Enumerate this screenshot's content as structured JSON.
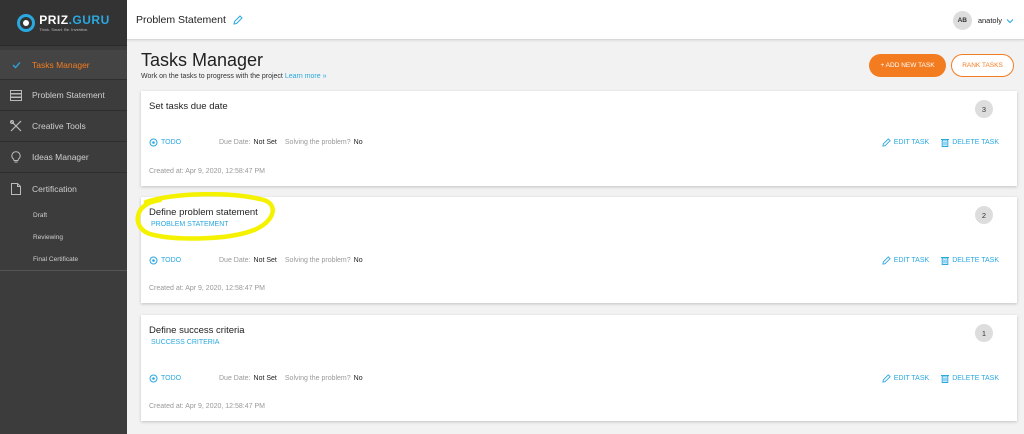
{
  "sidebar": {
    "logo": {
      "name_a": "PRIZ",
      "name_b": ".GURU",
      "tagline": "Think. Smart. Be. Inventive."
    },
    "items": [
      {
        "label": "Tasks Manager",
        "icon": "check-icon"
      },
      {
        "label": "Problem Statement",
        "icon": "list-icon"
      },
      {
        "label": "Creative Tools",
        "icon": "tools-icon"
      },
      {
        "label": "Ideas Manager",
        "icon": "lightbulb-icon"
      },
      {
        "label": "Certification",
        "icon": "document-icon"
      }
    ],
    "sub_items": [
      "Draft",
      "Reviewing",
      "Final Certificate"
    ]
  },
  "header": {
    "title": "Problem Statement",
    "user": {
      "initials": "AB",
      "name": "anatoly"
    }
  },
  "page": {
    "title": "Tasks Manager",
    "subtitle": "Work on the tasks to progress with the project",
    "learn_more": "Learn more »",
    "add_task": "+ ADD NEW TASK",
    "rank_tasks": "RANK TASKS"
  },
  "tasks": [
    {
      "title": "Set tasks due date",
      "link": "",
      "rank": "3",
      "status": "TODO",
      "due_label": "Due Date:",
      "due_value": "Not Set",
      "solving_label": "Solving the problem?",
      "solving_value": "No",
      "edit": "EDIT TASK",
      "delete": "DELETE TASK",
      "created": "Created at: Apr 9, 2020, 12:58:47 PM"
    },
    {
      "title": "Define problem statement",
      "link": "PROBLEM STATEMENT",
      "rank": "2",
      "status": "TODO",
      "due_label": "Due Date:",
      "due_value": "Not Set",
      "solving_label": "Solving the problem?",
      "solving_value": "No",
      "edit": "EDIT TASK",
      "delete": "DELETE TASK",
      "created": "Created at: Apr 9, 2020, 12:58:47 PM"
    },
    {
      "title": "Define success criteria",
      "link": "SUCCESS CRITERIA",
      "rank": "1",
      "status": "TODO",
      "due_label": "Due Date:",
      "due_value": "Not Set",
      "solving_label": "Solving the problem?",
      "solving_value": "No",
      "edit": "EDIT TASK",
      "delete": "DELETE TASK",
      "created": "Created at: Apr 9, 2020, 12:58:47 PM"
    }
  ],
  "colors": {
    "accent": "#2aa8e0",
    "brand": "#f47c20",
    "highlight": "#f5f200",
    "sidebar": "#3c3c3c"
  }
}
